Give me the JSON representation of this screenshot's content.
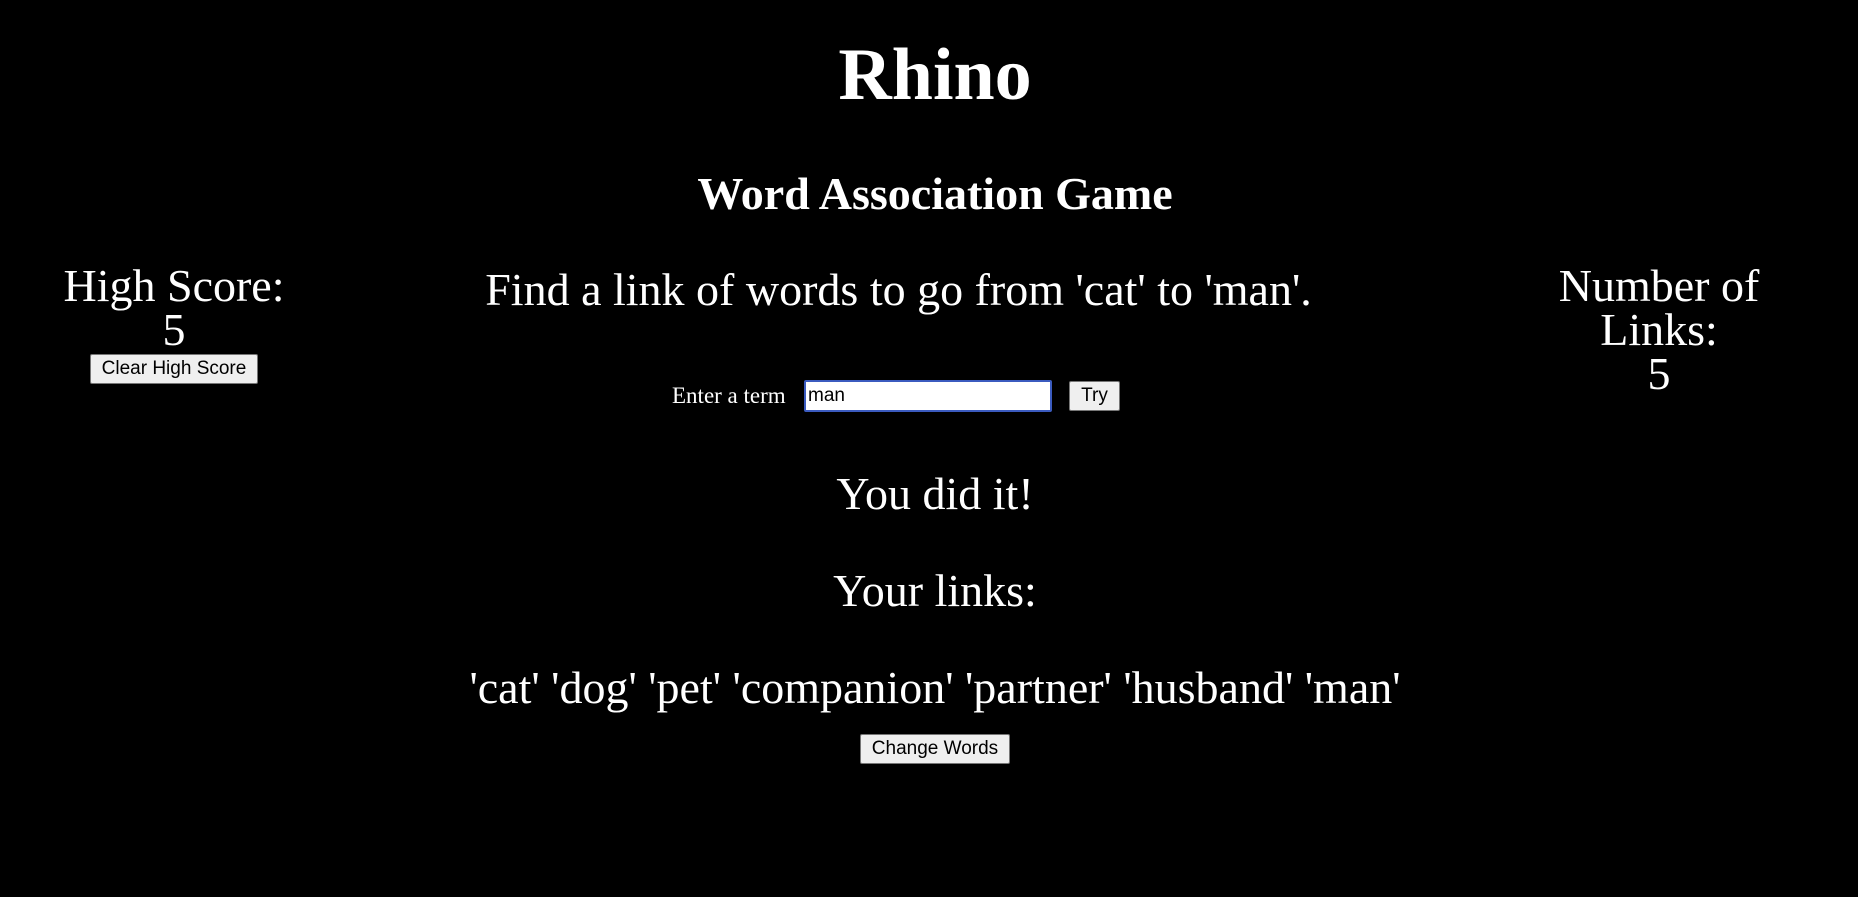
{
  "header": {
    "title": "Rhino",
    "subtitle": "Word Association Game"
  },
  "game": {
    "instructions": "Find a link of words to go from 'cat' to 'man'.",
    "term_label": "Enter a term",
    "term_value": "man",
    "try_label": "Try",
    "result": "You did it!",
    "links_heading": "Your links:",
    "links": [
      "'cat'",
      "'dog'",
      "'pet'",
      "'companion'",
      "'partner'",
      "'husband'",
      "'man'"
    ],
    "change_words_label": "Change Words"
  },
  "high_score": {
    "label": "High Score:",
    "value": "5",
    "clear_label": "Clear High Score"
  },
  "num_links": {
    "label_line1": "Number of",
    "label_line2": "Links:",
    "value": "5"
  }
}
